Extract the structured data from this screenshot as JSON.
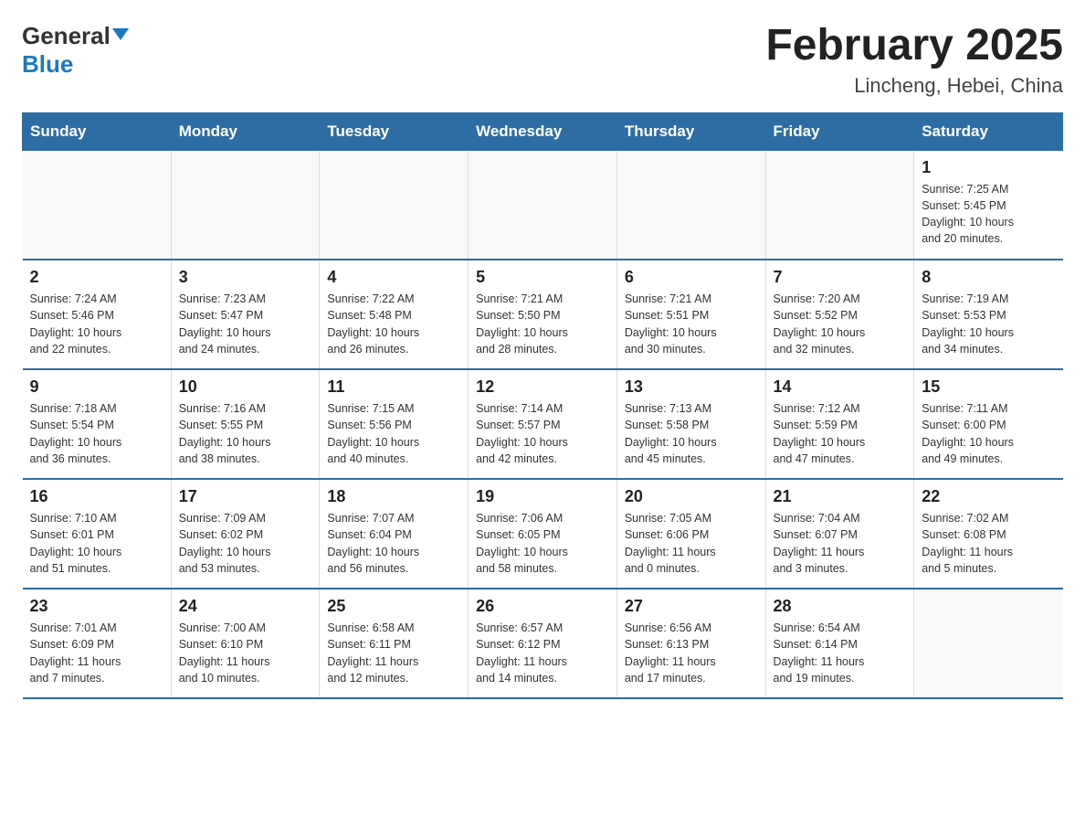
{
  "header": {
    "logo_general": "General",
    "logo_blue": "Blue",
    "title": "February 2025",
    "subtitle": "Lincheng, Hebei, China"
  },
  "calendar": {
    "days_of_week": [
      "Sunday",
      "Monday",
      "Tuesday",
      "Wednesday",
      "Thursday",
      "Friday",
      "Saturday"
    ],
    "weeks": [
      [
        {
          "day": "",
          "info": ""
        },
        {
          "day": "",
          "info": ""
        },
        {
          "day": "",
          "info": ""
        },
        {
          "day": "",
          "info": ""
        },
        {
          "day": "",
          "info": ""
        },
        {
          "day": "",
          "info": ""
        },
        {
          "day": "1",
          "info": "Sunrise: 7:25 AM\nSunset: 5:45 PM\nDaylight: 10 hours\nand 20 minutes."
        }
      ],
      [
        {
          "day": "2",
          "info": "Sunrise: 7:24 AM\nSunset: 5:46 PM\nDaylight: 10 hours\nand 22 minutes."
        },
        {
          "day": "3",
          "info": "Sunrise: 7:23 AM\nSunset: 5:47 PM\nDaylight: 10 hours\nand 24 minutes."
        },
        {
          "day": "4",
          "info": "Sunrise: 7:22 AM\nSunset: 5:48 PM\nDaylight: 10 hours\nand 26 minutes."
        },
        {
          "day": "5",
          "info": "Sunrise: 7:21 AM\nSunset: 5:50 PM\nDaylight: 10 hours\nand 28 minutes."
        },
        {
          "day": "6",
          "info": "Sunrise: 7:21 AM\nSunset: 5:51 PM\nDaylight: 10 hours\nand 30 minutes."
        },
        {
          "day": "7",
          "info": "Sunrise: 7:20 AM\nSunset: 5:52 PM\nDaylight: 10 hours\nand 32 minutes."
        },
        {
          "day": "8",
          "info": "Sunrise: 7:19 AM\nSunset: 5:53 PM\nDaylight: 10 hours\nand 34 minutes."
        }
      ],
      [
        {
          "day": "9",
          "info": "Sunrise: 7:18 AM\nSunset: 5:54 PM\nDaylight: 10 hours\nand 36 minutes."
        },
        {
          "day": "10",
          "info": "Sunrise: 7:16 AM\nSunset: 5:55 PM\nDaylight: 10 hours\nand 38 minutes."
        },
        {
          "day": "11",
          "info": "Sunrise: 7:15 AM\nSunset: 5:56 PM\nDaylight: 10 hours\nand 40 minutes."
        },
        {
          "day": "12",
          "info": "Sunrise: 7:14 AM\nSunset: 5:57 PM\nDaylight: 10 hours\nand 42 minutes."
        },
        {
          "day": "13",
          "info": "Sunrise: 7:13 AM\nSunset: 5:58 PM\nDaylight: 10 hours\nand 45 minutes."
        },
        {
          "day": "14",
          "info": "Sunrise: 7:12 AM\nSunset: 5:59 PM\nDaylight: 10 hours\nand 47 minutes."
        },
        {
          "day": "15",
          "info": "Sunrise: 7:11 AM\nSunset: 6:00 PM\nDaylight: 10 hours\nand 49 minutes."
        }
      ],
      [
        {
          "day": "16",
          "info": "Sunrise: 7:10 AM\nSunset: 6:01 PM\nDaylight: 10 hours\nand 51 minutes."
        },
        {
          "day": "17",
          "info": "Sunrise: 7:09 AM\nSunset: 6:02 PM\nDaylight: 10 hours\nand 53 minutes."
        },
        {
          "day": "18",
          "info": "Sunrise: 7:07 AM\nSunset: 6:04 PM\nDaylight: 10 hours\nand 56 minutes."
        },
        {
          "day": "19",
          "info": "Sunrise: 7:06 AM\nSunset: 6:05 PM\nDaylight: 10 hours\nand 58 minutes."
        },
        {
          "day": "20",
          "info": "Sunrise: 7:05 AM\nSunset: 6:06 PM\nDaylight: 11 hours\nand 0 minutes."
        },
        {
          "day": "21",
          "info": "Sunrise: 7:04 AM\nSunset: 6:07 PM\nDaylight: 11 hours\nand 3 minutes."
        },
        {
          "day": "22",
          "info": "Sunrise: 7:02 AM\nSunset: 6:08 PM\nDaylight: 11 hours\nand 5 minutes."
        }
      ],
      [
        {
          "day": "23",
          "info": "Sunrise: 7:01 AM\nSunset: 6:09 PM\nDaylight: 11 hours\nand 7 minutes."
        },
        {
          "day": "24",
          "info": "Sunrise: 7:00 AM\nSunset: 6:10 PM\nDaylight: 11 hours\nand 10 minutes."
        },
        {
          "day": "25",
          "info": "Sunrise: 6:58 AM\nSunset: 6:11 PM\nDaylight: 11 hours\nand 12 minutes."
        },
        {
          "day": "26",
          "info": "Sunrise: 6:57 AM\nSunset: 6:12 PM\nDaylight: 11 hours\nand 14 minutes."
        },
        {
          "day": "27",
          "info": "Sunrise: 6:56 AM\nSunset: 6:13 PM\nDaylight: 11 hours\nand 17 minutes."
        },
        {
          "day": "28",
          "info": "Sunrise: 6:54 AM\nSunset: 6:14 PM\nDaylight: 11 hours\nand 19 minutes."
        },
        {
          "day": "",
          "info": ""
        }
      ]
    ]
  }
}
